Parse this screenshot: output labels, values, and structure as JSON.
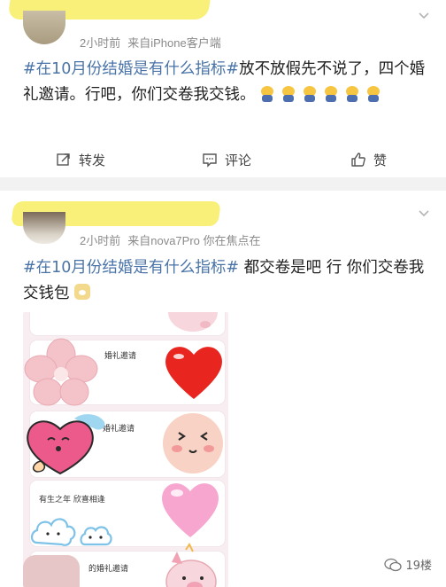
{
  "post1": {
    "meta_time": "2小时前",
    "meta_source": "来自iPhone客户端",
    "topic": "#在10月份结婚是有什么指标#",
    "text": "放不放假先不说了，四个婚礼邀请。行吧，你们交卷我交钱。",
    "emoji_name": "crying-emoji",
    "emoji_count": 6
  },
  "actions": {
    "repost_label": "转发",
    "comment_label": "评论",
    "like_label": "赞"
  },
  "post2": {
    "meta_time": "2小时前",
    "meta_source": "来自nova7Pro 你在焦点在",
    "topic": "#在10月份结婚是有什么指标#",
    "text": " 都交卷是吧 行 你们交卷我交钱包",
    "emoji_name": "dog-emoji"
  },
  "photo": {
    "card1_text": "婚礼邀请",
    "card2_text": "婚礼邀请",
    "card3_text": "有生之年  欣喜相逢",
    "card4_text": "的婚礼邀请"
  },
  "watermark": {
    "label": "19楼"
  },
  "colors": {
    "topic": "#4a74a8",
    "meta": "#8a8a8a",
    "highlight": "#f9ef72",
    "separator": "#f2f2f2"
  }
}
